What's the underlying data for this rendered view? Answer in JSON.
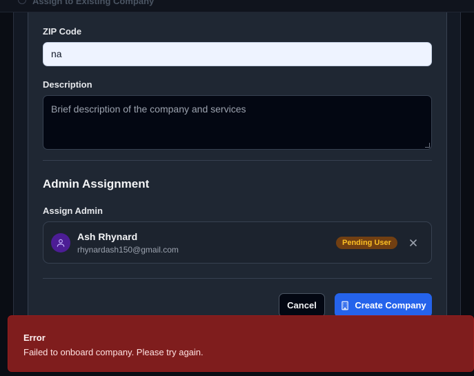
{
  "background": {
    "option_label": "Assign to Existing Company"
  },
  "form": {
    "zip": {
      "label": "ZIP Code",
      "value": "na"
    },
    "description": {
      "label": "Description",
      "placeholder": "Brief description of the company and services"
    }
  },
  "admin_section": {
    "title": "Admin Assignment",
    "assign_label": "Assign Admin",
    "admin": {
      "name": "Ash Rhynard",
      "email": "rhynardash150@gmail.com",
      "badge": "Pending User",
      "avatar_icon": "user-icon",
      "remove_icon": "close-icon"
    }
  },
  "actions": {
    "cancel_label": "Cancel",
    "create_label": "Create Company",
    "create_icon": "building-icon"
  },
  "toast": {
    "title": "Error",
    "message": "Failed to onboard company. Please try again."
  },
  "colors": {
    "accent": "#2563eb",
    "error": "#7f1d1d",
    "badge_bg": "#713f12",
    "badge_text": "#fbbf24",
    "avatar_bg": "#4c1d95"
  }
}
